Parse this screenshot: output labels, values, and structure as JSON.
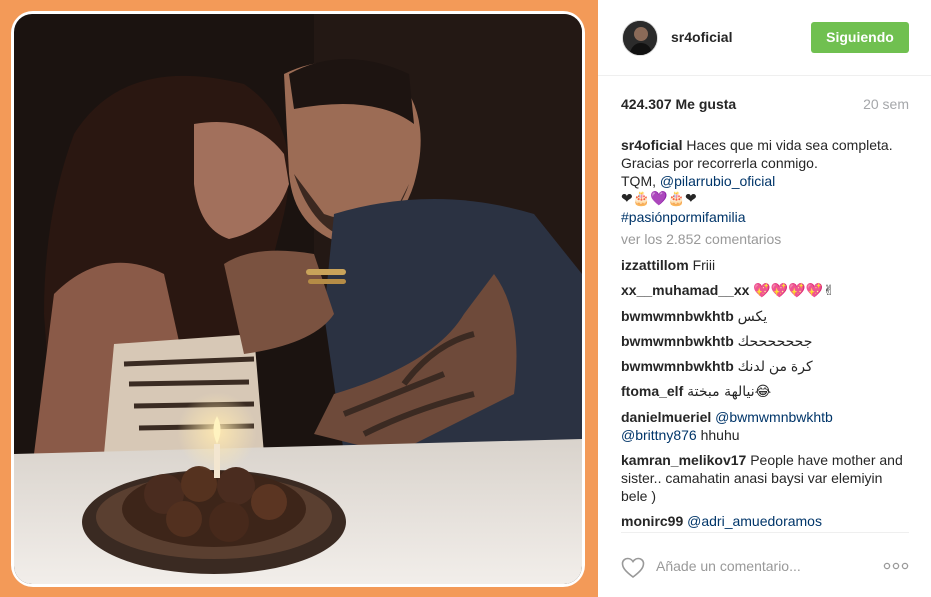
{
  "post": {
    "username": "sr4oficial",
    "follow_label": "Siguiendo",
    "likes": "424.307 Me gusta",
    "age": "20 sem",
    "caption": {
      "user": "sr4oficial",
      "line1": "Haces que mi vida sea completa.",
      "line2": "Gracias por recorrerla conmigo.",
      "line3_prefix": "TQM,",
      "mention": "@pilarrubio_oficial",
      "emojis": "❤🎂💜🎂❤",
      "hashtag": "#pasiónpormifamilia"
    },
    "view_all": "ver los 2.852 comentarios",
    "comments": [
      {
        "user": "izzattillom",
        "text": "Friii"
      },
      {
        "user": "xx__muhamad__xx",
        "text": "💖💖💖💖✌"
      },
      {
        "user": "bwmwmnbwkhtb",
        "text": "يكس"
      },
      {
        "user": "bwmwmnbwkhtb",
        "text": "جححححححك"
      },
      {
        "user": "bwmwmnbwkhtb",
        "text": "كرة من لدنك"
      },
      {
        "user": "ftoma_elf",
        "text": "نيالهة مبختة😂"
      },
      {
        "user": "danielmueriel",
        "mention1": "@bwmwmnbwkhtb",
        "mention2": "@brittny876",
        "text": "hhuhu"
      },
      {
        "user": "kamran_melikov17",
        "text": "People have mother and sister.. camahatin anasi baysi var elemiyin bele )"
      },
      {
        "user": "monirc99",
        "mention1": "@adri_amuedoramos"
      }
    ],
    "add_comment_placeholder": "Añade un comentario...",
    "more_label": "ooo",
    "icons": {
      "like": "heart-icon",
      "more": "more-options-icon",
      "avatar": "avatar"
    },
    "colors": {
      "follow": "#70c050",
      "link": "#003569",
      "muted": "#999999",
      "frame": "#f39a58"
    }
  }
}
